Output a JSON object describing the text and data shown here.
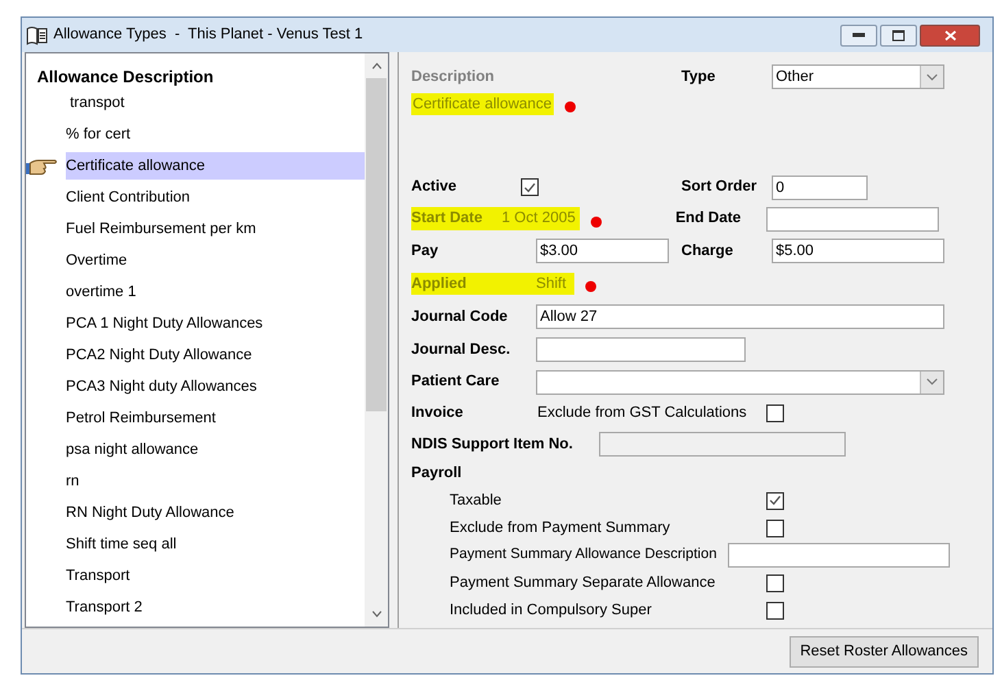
{
  "window": {
    "title": "Allowance Types  -  This Planet - Venus Test 1"
  },
  "list": {
    "heading": "Allowance Description",
    "items": [
      {
        "label": "transpot",
        "selected": false
      },
      {
        "label": "% for cert",
        "selected": false
      },
      {
        "label": "Certificate allowance",
        "selected": true
      },
      {
        "label": "Client Contribution",
        "selected": false
      },
      {
        "label": "Fuel Reimbursement per km",
        "selected": false
      },
      {
        "label": "Overtime",
        "selected": false
      },
      {
        "label": "overtime 1",
        "selected": false
      },
      {
        "label": "PCA 1 Night Duty Allowances",
        "selected": false
      },
      {
        "label": "PCA2 Night Duty Allowance",
        "selected": false
      },
      {
        "label": "PCA3 Night duty Allowances",
        "selected": false
      },
      {
        "label": "Petrol Reimbursement",
        "selected": false
      },
      {
        "label": "psa night allowance",
        "selected": false
      },
      {
        "label": "rn",
        "selected": false
      },
      {
        "label": "RN Night Duty Allowance",
        "selected": false
      },
      {
        "label": "Shift time seq all",
        "selected": false
      },
      {
        "label": "Transport",
        "selected": false
      },
      {
        "label": "Transport 2",
        "selected": false
      }
    ]
  },
  "form": {
    "description": {
      "label": "Description",
      "value": "Certificate allowance",
      "highlighted": true,
      "marked": true
    },
    "type": {
      "label": "Type",
      "value": "Other"
    },
    "active": {
      "label": "Active",
      "checked": true
    },
    "sort_order": {
      "label": "Sort Order",
      "value": "0"
    },
    "start_date": {
      "label": "Start Date",
      "value": "1 Oct 2005",
      "highlighted": true,
      "marked": true
    },
    "end_date": {
      "label": "End Date"
    },
    "pay": {
      "label": "Pay",
      "value": "$3.00"
    },
    "charge": {
      "label": "Charge",
      "value": "$5.00"
    },
    "applied": {
      "label": "Applied",
      "value": "Shift",
      "highlighted": true,
      "marked": true
    },
    "journal_code": {
      "label": "Journal Code",
      "value": "Allow 27"
    },
    "journal_desc": {
      "label": "Journal Desc."
    },
    "patient_care": {
      "label": "Patient Care"
    },
    "invoice": {
      "label": "Invoice",
      "option": "Exclude from GST Calculations",
      "checked": false
    },
    "ndis": {
      "label": "NDIS Support Item No."
    },
    "payroll": {
      "label": "Payroll",
      "options": [
        {
          "kind": "checkbox",
          "label": "Taxable",
          "checked": true
        },
        {
          "kind": "checkbox",
          "label": "Exclude from Payment Summary",
          "checked": false
        },
        {
          "kind": "text",
          "label": "Payment Summary Allowance Description"
        },
        {
          "kind": "checkbox",
          "label": "Payment Summary Separate Allowance",
          "checked": false
        },
        {
          "kind": "checkbox",
          "label": "Included in Compulsory Super",
          "checked": false
        }
      ]
    }
  },
  "buttons": [
    {
      "label": "Reset Roster Allowances"
    }
  ]
}
